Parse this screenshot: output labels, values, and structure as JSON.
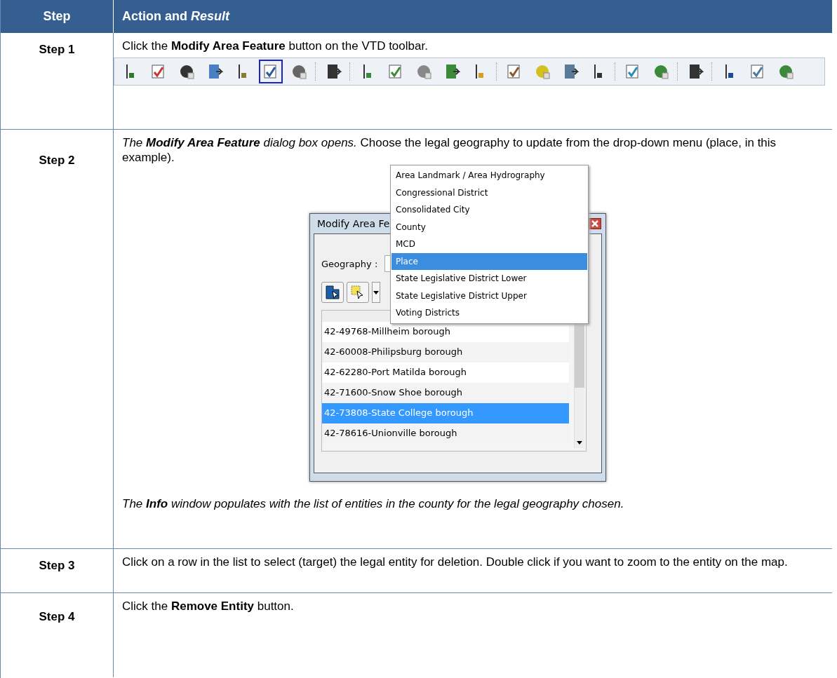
{
  "table": {
    "columns": [
      "Step",
      "Action and *Result*"
    ],
    "rows": [
      {
        "kind": "toolbar",
        "step": "Step 1",
        "text": "Click the **Modify Area Feature** button on the VTD toolbar.",
        "toolbar": [
          {
            "selected": false
          },
          {
            "selected": false
          },
          {
            "selected": false
          },
          {
            "selected": false
          },
          {
            "selected": false
          },
          {
            "selected": true
          },
          {
            "selected": false
          },
          {
            "selected": false
          },
          {
            "selected": false
          },
          {
            "selected": false
          },
          {
            "selected": false
          },
          {
            "selected": false
          },
          {
            "selected": false
          },
          {
            "selected": false
          },
          {
            "selected": false
          },
          {
            "selected": false
          },
          {
            "selected": false
          },
          {
            "selected": false
          },
          {
            "selected": false
          },
          {
            "selected": false
          },
          {
            "selected": false
          },
          {
            "selected": false
          },
          {
            "selected": false
          }
        ]
      },
      {
        "kind": "dialog",
        "step": "Step 2",
        "lead": "The **Modify Area Feature** dialog box opens.",
        "text": "Choose the legal geography to update from the drop-down menu (place, in this example).",
        "dialog": {
          "title": "Modify Area Fe",
          "geography_label": "Geography :",
          "dropdown": [
            {
              "label": "Area Landmark / Area Hydrography",
              "selected": false
            },
            {
              "label": "Congressional District",
              "selected": false
            },
            {
              "label": "Consolidated City",
              "selected": false
            },
            {
              "label": "County",
              "selected": false
            },
            {
              "label": "MCD",
              "selected": false
            },
            {
              "label": "Place",
              "selected": true
            },
            {
              "label": "State Legislative District Lower",
              "selected": false
            },
            {
              "label": "State Legislative District Upper",
              "selected": false
            },
            {
              "label": "Voting Districts",
              "selected": false
            }
          ],
          "list": [
            {
              "label": "42-49768-Millheim borough",
              "selected": false
            },
            {
              "label": "42-60008-Philipsburg borough",
              "selected": false
            },
            {
              "label": "42-62280-Port Matilda borough",
              "selected": false
            },
            {
              "label": "42-71600-Snow Shoe borough",
              "selected": false
            },
            {
              "label": "42-73808-State College borough",
              "selected": true
            },
            {
              "label": "42-78616-Unionville borough",
              "selected": false
            }
          ]
        },
        "note": "The **Info** window populates with the list of entities in the county for the legal geography chosen."
      },
      {
        "kind": "text",
        "step": "Step 3",
        "text": "Click on a row in the list to select (target) the legal entity for deletion. Double click if you want to zoom to the entity on the map."
      },
      {
        "kind": "text",
        "step": "Step 4",
        "text": "Click the **Remove Entity** button."
      }
    ]
  }
}
